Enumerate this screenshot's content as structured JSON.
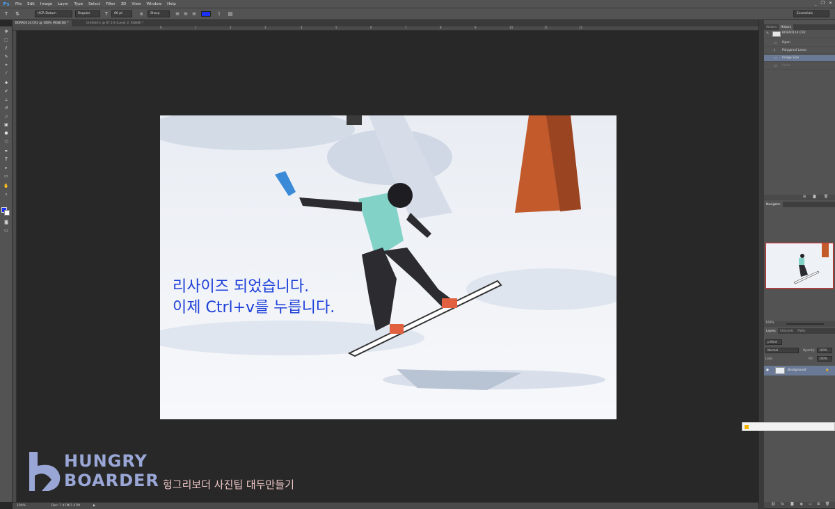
{
  "app": {
    "logo": "Ps",
    "menu": [
      "File",
      "Edit",
      "Image",
      "Layer",
      "Type",
      "Select",
      "Filter",
      "3D",
      "View",
      "Window",
      "Help"
    ],
    "window_controls": [
      "_",
      "❐",
      "✕"
    ]
  },
  "options_bar": {
    "font_family": "HCR Dotum",
    "font_style": "Regular",
    "font_size": "66 pt",
    "anti_alias": "Sharp",
    "text_color": "#1a31f5",
    "workspace": "Essentials"
  },
  "tabs": [
    {
      "label": "BORA0114.CR2 @ 100% (RGB/16) *",
      "active": true
    },
    {
      "label": "Untitled-1 @ 87.1% (Layer 2, RGB/8) *",
      "active": false
    }
  ],
  "ruler_ticks": [
    "0",
    "1",
    "2",
    "3",
    "4",
    "5",
    "6",
    "7",
    "8",
    "9",
    "10",
    "11",
    "12"
  ],
  "canvas": {
    "caption_line1": "리사이즈 되었습니다.",
    "caption_line2": "이제 Ctrl+v를 누릅니다."
  },
  "watermark": {
    "line1": "HUNGRY",
    "line2": "BOARDER",
    "subtitle": "헝그리보더 사진팁 대두만들기"
  },
  "status": {
    "zoom": "100%",
    "doc": "Doc: 7.47M/7.47M"
  },
  "panels": {
    "history": {
      "tabs": [
        "Actions",
        "History"
      ],
      "snapshot": "BORA0114.CR2",
      "items": [
        {
          "label": "Open",
          "state": "normal"
        },
        {
          "label": "Polygonal Lasso",
          "state": "normal"
        },
        {
          "label": "Image Size",
          "state": "selected"
        },
        {
          "label": "Paste",
          "state": "dimmed"
        }
      ]
    },
    "navigator": {
      "title": "Navigator",
      "zoom": "100%"
    },
    "layers": {
      "tabs": [
        "Layers",
        "Channels",
        "Paths"
      ],
      "kind": "ρ Kind",
      "blend_mode": "Normal",
      "opacity_label": "Opacity:",
      "opacity_value": "100%",
      "lock_label": "Lock:",
      "fill_label": "Fill:",
      "fill_value": "100%",
      "layer_name": "Background"
    }
  },
  "progress": {
    "value": 0.05
  }
}
